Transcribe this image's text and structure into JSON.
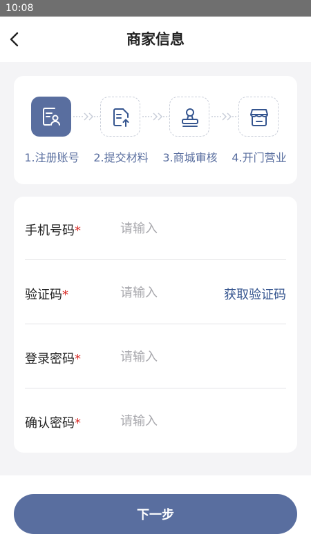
{
  "status_bar": {
    "time": "10:08"
  },
  "header": {
    "title": "商家信息",
    "back_icon": "chevron-left-icon"
  },
  "steps": [
    {
      "label": "1.注册账号",
      "icon": "register-account-icon",
      "active": true
    },
    {
      "label": "2.提交材料",
      "icon": "submit-document-icon",
      "active": false
    },
    {
      "label": "3.商城审核",
      "icon": "audit-stamp-icon",
      "active": false
    },
    {
      "label": "4.开门营业",
      "icon": "open-store-icon",
      "active": false
    }
  ],
  "form": {
    "phone": {
      "label": "手机号码",
      "required_mark": "*",
      "placeholder": "请输入",
      "value": ""
    },
    "code": {
      "label": "验证码",
      "required_mark": "*",
      "placeholder": "请输入",
      "value": "",
      "get_code_label": "获取验证码"
    },
    "password": {
      "label": "登录密码",
      "required_mark": "*",
      "placeholder": "请输入",
      "value": ""
    },
    "confirm_password": {
      "label": "确认密码",
      "required_mark": "*",
      "placeholder": "请输入",
      "value": ""
    }
  },
  "footer": {
    "next_label": "下一步"
  },
  "colors": {
    "primary": "#596e9f",
    "link": "#35558f",
    "required": "#d9302b",
    "placeholder": "#a8a8ad",
    "status_bar": "#6f6f6f"
  }
}
